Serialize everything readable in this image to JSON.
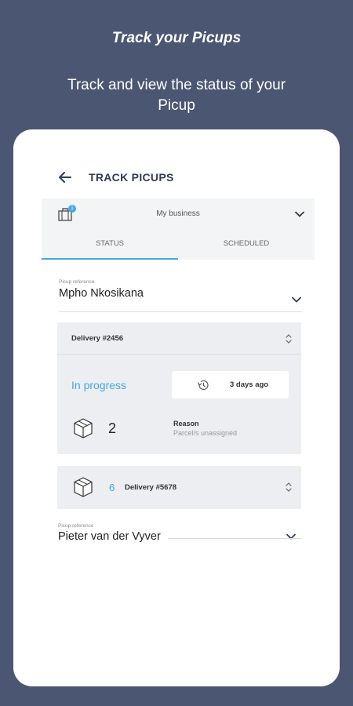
{
  "promo": {
    "title": "Track your Picups",
    "subtitle": "Track and view the status of your Picup"
  },
  "appbar": {
    "title": "TRACK PICUPS",
    "back_icon": "arrow-left-icon"
  },
  "business": {
    "label": "My business",
    "badge": "1"
  },
  "tabs": [
    {
      "label": "STATUS",
      "selected": true
    },
    {
      "label": "SCHEDULED",
      "selected": false
    }
  ],
  "picups": [
    {
      "ref_label": "Picup reference",
      "name": "Mpho Nkosikana",
      "deliveries": [
        {
          "title": "Delivery #2456",
          "status": "In progress",
          "time": "3 days ago",
          "count": "2",
          "reason_label": "Reason",
          "reason": "Parcel/s unassigned"
        },
        {
          "title": "Delivery #5678",
          "count": "6"
        }
      ]
    },
    {
      "ref_label": "Picup reference",
      "name": "Pieter van der Vyver"
    }
  ],
  "colors": {
    "background": "#4b5673",
    "accent": "#3fa9e0",
    "card": "#ffffff",
    "delivery_bg": "#eceef1"
  }
}
